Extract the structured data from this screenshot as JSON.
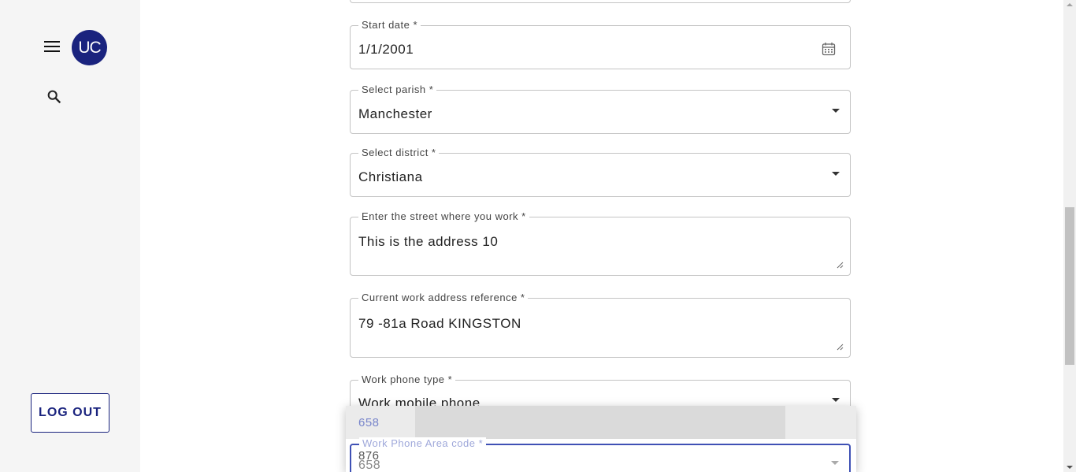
{
  "sidebar": {
    "avatar_initials": "UC",
    "logout_label": "LOG OUT",
    "icons": [
      "menu-icon",
      "search-icon"
    ]
  },
  "form": {
    "start_date": {
      "label": "Start date *",
      "value": "1/1/2001",
      "icon": "calendar-icon"
    },
    "parish": {
      "label": "Select parish *",
      "value": "Manchester"
    },
    "district": {
      "label": "Select district *",
      "value": "Christiana"
    },
    "street": {
      "label": "Enter the street where you work *",
      "value": "This is the address 10"
    },
    "address_reference": {
      "label": "Current work address reference *",
      "value": "79 -81a Road KINGSTON"
    },
    "phone_type": {
      "label": "Work phone type *",
      "value": "Work mobile phone"
    },
    "area_code": {
      "label": "Work Phone Area code *",
      "value": "658"
    }
  },
  "area_code_options": [
    "658",
    "876"
  ],
  "colors": {
    "accent": "#1a237e",
    "focus": "#3f51b5"
  }
}
